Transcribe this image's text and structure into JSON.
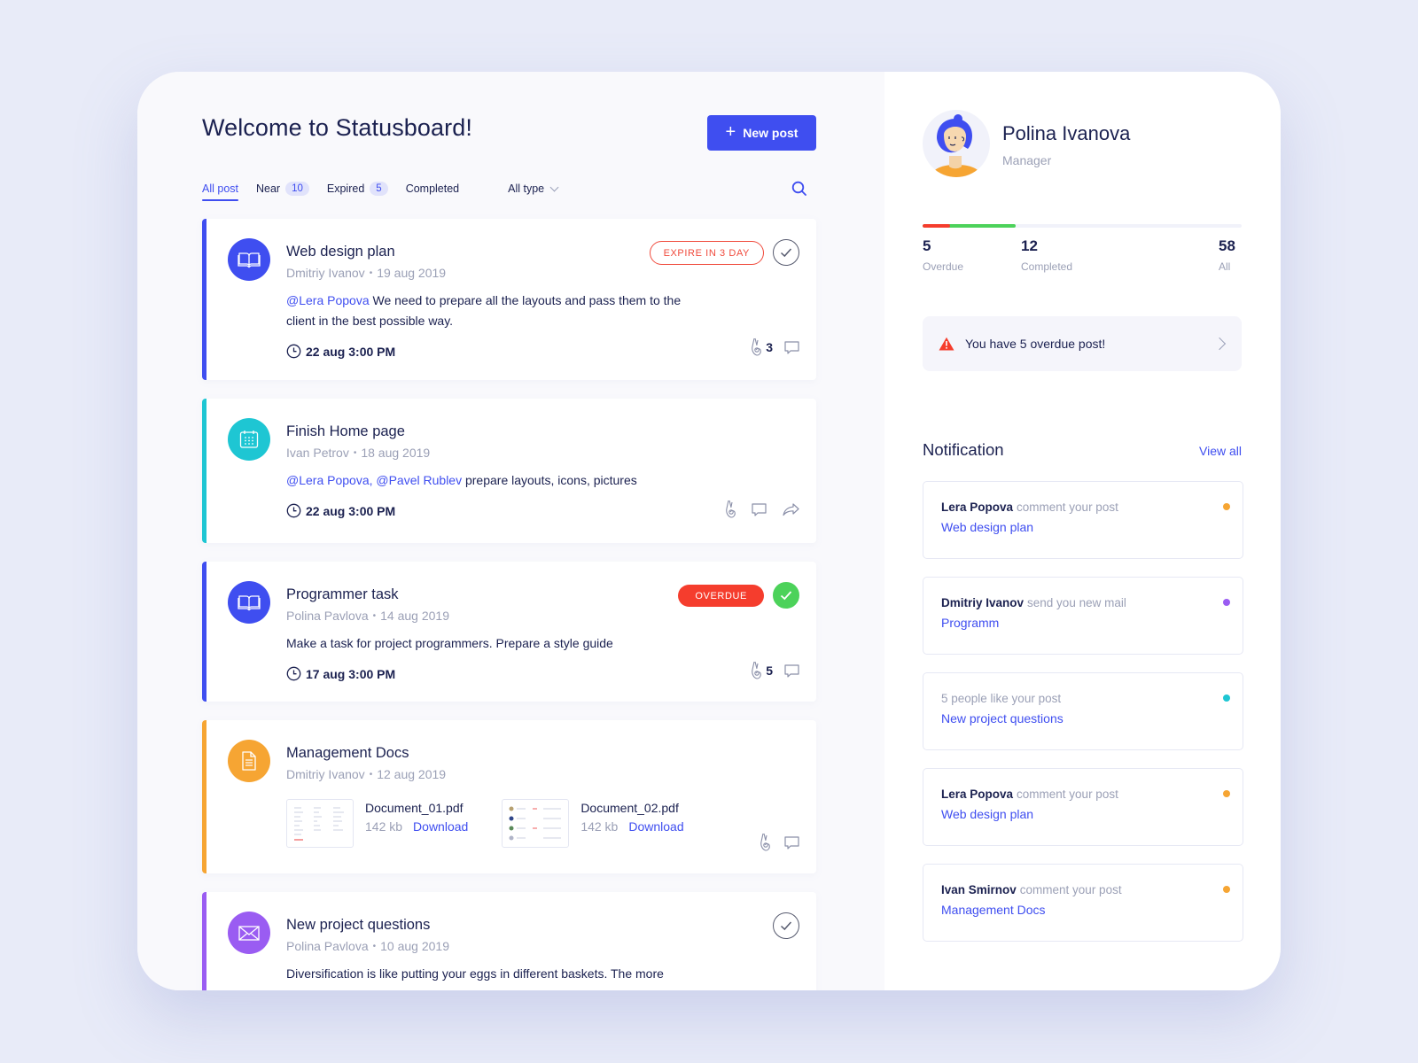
{
  "main": {
    "title": "Welcome to Statusboard!",
    "new_post_label": "New post",
    "tabs": [
      {
        "label": "All post",
        "active": true
      },
      {
        "label": "Near",
        "count": "10"
      },
      {
        "label": "Expired",
        "count": "5"
      },
      {
        "label": "Completed"
      }
    ],
    "type_filter": "All type",
    "posts": [
      {
        "title": "Web design plan",
        "author": "Dmitriy Ivanov",
        "date": "19 aug 2019",
        "mention": "@Lera Popova",
        "body": " We need to prepare all the layouts and pass them to the client in the best possible way.",
        "due": "22 aug 3:00 PM",
        "badge": "EXPIRE IN 3 DAY",
        "likes": "3",
        "color": "#3f4ef0",
        "icon": "book-icon"
      },
      {
        "title": "Finish Home page",
        "author": "Ivan Petrov",
        "date": "18 aug 2019",
        "mention": "@Lera Popova, @Pavel Rublev",
        "body": " prepare layouts, icons, pictures",
        "due": "22 aug 3:00 PM",
        "color": "#1ec6d3",
        "icon": "calendar-icon"
      },
      {
        "title": "Programmer task",
        "author": "Polina Pavlova",
        "date": "14 aug 2019",
        "body": "Make a task for project programmers. Prepare a style guide",
        "due": "17 aug 3:00 PM",
        "badge": "OVERDUE",
        "likes": "5",
        "color": "#3f4ef0",
        "icon": "book-icon"
      },
      {
        "title": "Management Docs",
        "author": "Dmitriy Ivanov",
        "date": "12 aug 2019",
        "documents": [
          {
            "name": "Document_01.pdf",
            "size": "142 kb",
            "action": "Download"
          },
          {
            "name": "Document_02.pdf",
            "size": "142 kb",
            "action": "Download"
          }
        ],
        "color": "#f6a533",
        "icon": "document-icon"
      },
      {
        "title": "New project questions",
        "author": "Polina Pavlova",
        "date": "10 aug 2019",
        "body": "Diversification is like putting your eggs in different baskets. The more",
        "color": "#9a5cf2",
        "icon": "mail-icon"
      }
    ]
  },
  "sidebar": {
    "profile": {
      "name": "Polina Ivanova",
      "role": "Manager"
    },
    "stats": {
      "overdue": {
        "value": "5",
        "label": "Overdue"
      },
      "completed": {
        "value": "12",
        "label": "Completed"
      },
      "all": {
        "value": "58",
        "label": "All"
      }
    },
    "progress": {
      "overdue_fraction": 0.086,
      "completed_fraction": 0.207
    },
    "alert": "You have 5 overdue post!",
    "notification_title": "Notification",
    "view_all": "View all",
    "notifications": [
      {
        "who": "Lera Popova",
        "action": "comment your post",
        "link": "Web design plan",
        "dot": "#f6a533"
      },
      {
        "who": "Dmitriy Ivanov",
        "action": "send you new mail",
        "link": "Programm",
        "dot": "#9a5cf2"
      },
      {
        "who": "",
        "action": "5 people like your post",
        "link": "New project questions",
        "dot": "#1ec6d3"
      },
      {
        "who": "Lera Popova",
        "action": "comment your post",
        "link": "Web design plan",
        "dot": "#f6a533"
      },
      {
        "who": "Ivan Smirnov",
        "action": "comment your post",
        "link": "Management Docs",
        "dot": "#f6a533"
      }
    ]
  },
  "colors": {
    "accent": "#3f4ef0",
    "danger": "#f53d2d",
    "success": "#4cd25a"
  }
}
